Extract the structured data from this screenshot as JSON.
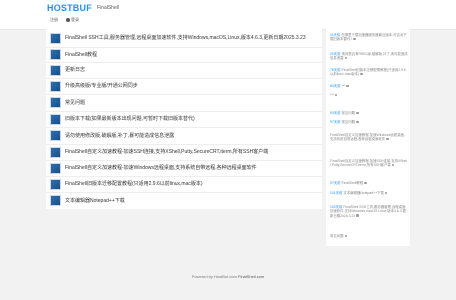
{
  "header": {
    "logo": "HOSTBUF",
    "nav_link": "FinalShell",
    "login_label": "注册",
    "register_label": "登录"
  },
  "topics": [
    {
      "title": "FinalShell SSH工具,服务器管理,远程桌面加速软件,支持Windows,macOS,Linux,版本4.6.3,更新日期2025.3.23"
    },
    {
      "title": "FinalShell教程"
    },
    {
      "title": "更新日志"
    },
    {
      "title": "升级高级版/专业版/开通公网同步"
    },
    {
      "title": "常见问题"
    },
    {
      "title": "旧版本下载(如果最新版本出现问题,可暂时下载旧版本替代)"
    },
    {
      "title": "请勿使用修改版,破解版,补丁,暴可能造成信息泄露"
    },
    {
      "title": "FinalShell自定义加速教程-加速SSH连接,支持XShell,Putty,SecureCRT,iterm,所有SSH客户端"
    },
    {
      "title": "FinalShell自定义加速教程-加速Windows远程桌面,支持系统自带远程,各种远程桌面软件"
    },
    {
      "title": "FinalShell旧版本迁移配置教程(只适用2.9.6以前linux,mac版本)"
    },
    {
      "title": "文本编辑器Notepad++下载"
    }
  ],
  "recent_replies": [
    {
      "user": "11天前",
      "text": "在哪里下载加速器服务器最近版本,可否对下载旧版本替代?"
    },
    {
      "user": "20天前",
      "text": "请问是否有RHEL版,破解版,补丁,请可能造成信息泄露"
    },
    {
      "user": "78天前",
      "text": "FinalShell旧版本迁移配置教程(只适用2.9.6以前linux,mac版本)"
    },
    {
      "user": "83天前",
      "text": "***"
    },
    {
      "user": "",
      "text": "***"
    },
    {
      "user": "93天前",
      "text": "常见问题"
    },
    {
      "user": "97天前",
      "text": "常见问题"
    },
    {
      "user": "",
      "text": "FinalShell自定义加速教程-加速Windows远程桌面,支持系统自带远程,各种远程桌面软件"
    },
    {
      "user": "",
      "text": "FinalShell自定义加速教程-加速SSH连接,支持XShell,Putty,SecureCRT,iterm,所有SSH客户端"
    },
    {
      "user": "97天前",
      "text": "FinalShell教程"
    },
    {
      "user": "101天前",
      "text": "文本编辑器Notepad++下载"
    },
    {
      "user": "102天前",
      "text": "FinalShell SSH工具,服务器管理,远程桌面加速软件,支持Windows,macOS,Linux,版本4.6.3,更新日期2025.3.23"
    },
    {
      "user": "",
      "text": "常见问题"
    }
  ],
  "footer": {
    "prefix": "Powered by HostBuf.com",
    "link": "FinalShell.com"
  }
}
